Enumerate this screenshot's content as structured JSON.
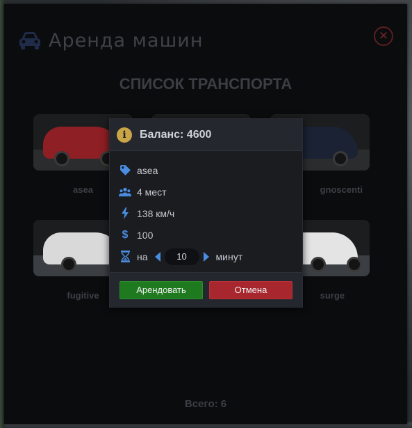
{
  "app": {
    "title": "Аренда машин",
    "title_icon": "car-icon",
    "close_icon": "close-icon"
  },
  "list": {
    "title": "СПИСОК ТРАНСПОРТА",
    "vehicles": [
      {
        "name": "asea",
        "color": "#8e1f24"
      },
      {
        "name": "",
        "color": "#3a3c40"
      },
      {
        "name": "cognoscenti",
        "color": "#1a2233"
      },
      {
        "name": "fugitive",
        "color": "#d9d9d9"
      },
      {
        "name": "",
        "color": "#3a3c40"
      },
      {
        "name": "surge",
        "color": "#e4e4e4"
      }
    ],
    "vehicle_label_visible": [
      "asea",
      "gnoscenti",
      "fugitive",
      "surge"
    ],
    "total": "Всего: 6"
  },
  "modal": {
    "balance": "Баланс: 4600",
    "info_icon": "info-icon",
    "rows": {
      "model": {
        "icon": "tag-icon",
        "text": "asea"
      },
      "seats": {
        "icon": "users-icon",
        "text": "4 мест"
      },
      "speed": {
        "icon": "bolt-icon",
        "text": "138 км/ч"
      },
      "price": {
        "icon": "dollar-icon",
        "text": "100"
      }
    },
    "duration": {
      "icon": "hourglass-icon",
      "prefix": "на",
      "value": "10",
      "suffix": "минут"
    },
    "rent_label": "Арендовать",
    "cancel_label": "Отмена"
  },
  "colors": {
    "accent_blue": "#4a8ce0",
    "rent_green": "#1f7a1f",
    "cancel_red": "#a8262e",
    "info_gold": "#c9a548"
  }
}
